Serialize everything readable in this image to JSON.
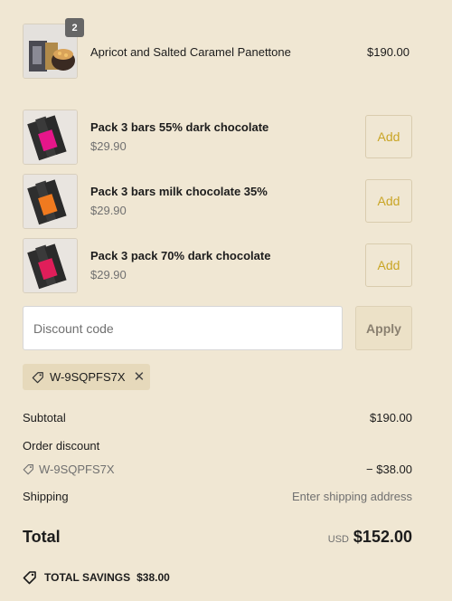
{
  "cart": {
    "items": [
      {
        "title": "Apricot and Salted Caramel Panettone",
        "quantity": "2",
        "price": "$190.00",
        "image_icon": "panettone-image"
      }
    ]
  },
  "upsell": {
    "items": [
      {
        "title": "Pack 3 bars 55% dark chocolate",
        "price": "$29.90",
        "button": "Add",
        "wrapper_color": "#e6168a"
      },
      {
        "title": "Pack 3 bars milk chocolate 35%",
        "price": "$29.90",
        "button": "Add",
        "wrapper_color": "#f07a1f"
      },
      {
        "title": "Pack 3 pack 70% dark chocolate",
        "price": "$29.90",
        "button": "Add",
        "wrapper_color": "#e01e5a"
      }
    ]
  },
  "discount": {
    "placeholder": "Discount code",
    "apply_label": "Apply",
    "applied_code": "W-9SQPFS7X"
  },
  "summary": {
    "subtotal_label": "Subtotal",
    "subtotal_value": "$190.00",
    "order_discount_label": "Order discount",
    "discount_code": "W-9SQPFS7X",
    "discount_value": "− $38.00",
    "shipping_label": "Shipping",
    "shipping_value": "Enter shipping address",
    "total_label": "Total",
    "currency": "USD",
    "total_value": "$152.00",
    "savings_label": "TOTAL SAVINGS",
    "savings_value": "$38.00"
  },
  "colors": {
    "background": "#f0e7d3",
    "accent": "#c9a525",
    "chip": "#e6d9bb"
  }
}
